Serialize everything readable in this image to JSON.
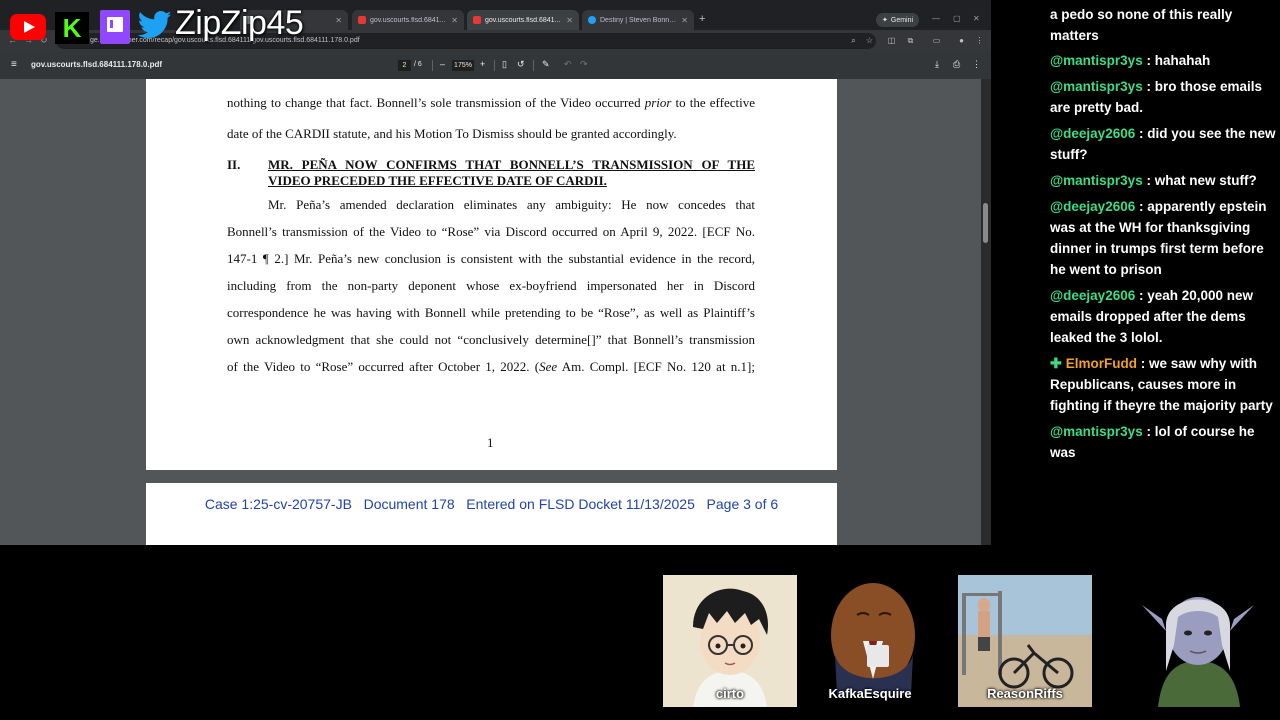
{
  "overlay": {
    "channel_name": "ZipZip45",
    "logos": [
      "youtube-logo",
      "kick-logo",
      "twitch-logo",
      "twitter-logo"
    ]
  },
  "browser": {
    "tabs": [
      {
        "label": "",
        "active": false,
        "color": "#9aa0a6"
      },
      {
        "label": "gov.uscourts.flsd.684111.132.0...",
        "active": false,
        "color": "#e53935"
      },
      {
        "label": "gov.uscourts.flsd.684111.178.0...",
        "active": true,
        "color": "#e53935"
      },
      {
        "label": "Destiny | Steven Bonnell II on X",
        "active": false,
        "color": "#1da1f2"
      }
    ],
    "gemini_label": "Gemini",
    "url": "ge.courtlistener.com/recap/gov.uscourts.flsd.684111/gov.uscourts.flsd.684111.178.0.pdf"
  },
  "pdf_toolbar": {
    "filename": "gov.uscourts.flsd.684111.178.0.pdf",
    "current_page": "2",
    "total_pages": "/ 6",
    "zoom": "175%",
    "zoom_out": "–",
    "zoom_in": "+"
  },
  "document": {
    "para1": {
      "line1_pre": "nothing to change that fact. Bonnell’s sole transmission of the Video occurred ",
      "line1_em": "prior",
      "line1_post": " to the effective",
      "line2": "date of the CARDII statute, and his Motion To Dismiss should be granted accordingly."
    },
    "heading_num": "II.",
    "heading_line1": "MR. PEÑA NOW CONFIRMS THAT BONNELL’S TRANSMISSION OF THE",
    "heading_line2": "VIDEO PRECEDED THE EFFECTIVE DATE OF CARDII.",
    "para2": [
      "Mr. Peña’s amended declaration eliminates any ambiguity: He now concedes that",
      "Bonnell’s transmission of the Video to “Rose” via Discord occurred on April 9, 2022. [ECF No.",
      "147-1 ¶ 2.] Mr. Peña’s new conclusion is consistent with the substantial evidence in the record,",
      "including from the non-party deponent whose ex-boyfriend impersonated her in Discord",
      "correspondence he was having with Bonnell while pretending to be “Rose”, as well as Plaintiff’s",
      "own acknowledgment that she could not “conclusively determine[]” that Bonnell’s transmission"
    ],
    "last_line_pre": "of the Video to “Rose” occurred after October 1, 2022. (",
    "last_line_em": "See",
    "last_line_post": " Am. Compl. [ECF No. 120 at n.1];",
    "page_number": "1",
    "stamp": "Case 1:25-cv-20757-JB   Document 178   Entered on FLSD Docket 11/13/2025   Page 3 of 6"
  },
  "chat": [
    {
      "user": "",
      "text": "a pedo so none of this really matters"
    },
    {
      "user": "@mantispr3ys",
      "text": " : hahahah"
    },
    {
      "user": "@mantispr3ys",
      "text": " : bro those emails are pretty bad."
    },
    {
      "user": "@deejay2606",
      "text": " : did you see the new stuff?"
    },
    {
      "user": "@mantispr3ys",
      "text": " : what new stuff?"
    },
    {
      "user": "@deejay2606",
      "text": " : apparently epstein was at the WH for thanksgiving dinner in trumps first term before he went to prison"
    },
    {
      "user": "@deejay2606",
      "text": " : yeah 20,000 new emails dropped after the dems leaked the 3 lolol."
    },
    {
      "user": "ElmorFudd",
      "text": " : we saw why with Republicans, causes more in fighting if theyre the majority party"
    },
    {
      "user": "@mantispr3ys",
      "text": " : lol of course he was"
    }
  ],
  "cams": [
    {
      "label": "cirto"
    },
    {
      "label": "KafkaEsquire"
    },
    {
      "label": "ReasonRiffs"
    }
  ]
}
